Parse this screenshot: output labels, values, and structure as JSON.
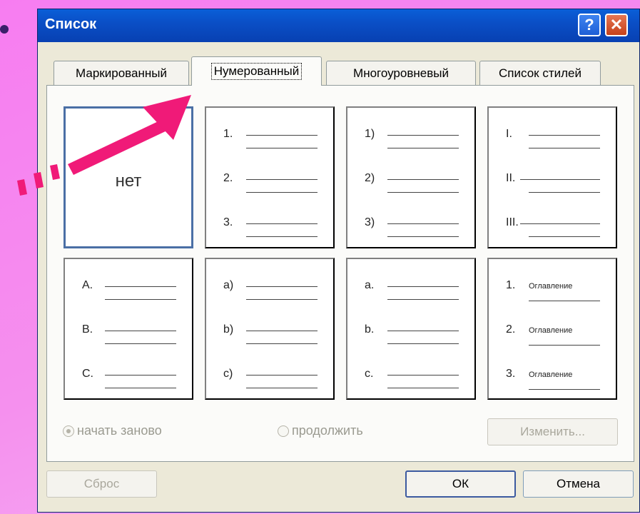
{
  "dialog": {
    "title": "Список",
    "help_icon": "?",
    "close_icon": "✕"
  },
  "tabs": [
    {
      "label": "Маркированный"
    },
    {
      "label": "Нумерованный"
    },
    {
      "label": "Многоуровневый"
    },
    {
      "label": "Список стилей"
    }
  ],
  "gallery": {
    "none_label": "нет",
    "styles": [
      {
        "markers": [
          "1.",
          "2.",
          "3."
        ]
      },
      {
        "markers": [
          "1)",
          "2)",
          "3)"
        ]
      },
      {
        "markers": [
          "I.",
          "II.",
          "III."
        ]
      },
      {
        "markers": [
          "A.",
          "B.",
          "C."
        ]
      },
      {
        "markers": [
          "a)",
          "b)",
          "c)"
        ]
      },
      {
        "markers": [
          "a.",
          "b.",
          "c."
        ]
      },
      {
        "markers": [
          "1.",
          "2.",
          "3."
        ],
        "item_text": "Оглавление"
      }
    ]
  },
  "options": {
    "restart_label": "начать заново",
    "continue_label": "продолжить"
  },
  "buttons": {
    "change": "Изменить...",
    "reset": "Сброс",
    "ok": "ОК",
    "cancel": "Отмена"
  },
  "colors": {
    "background": "#f77df1",
    "arrow": "#f01a78",
    "titlebar": "#0a4fc6"
  }
}
